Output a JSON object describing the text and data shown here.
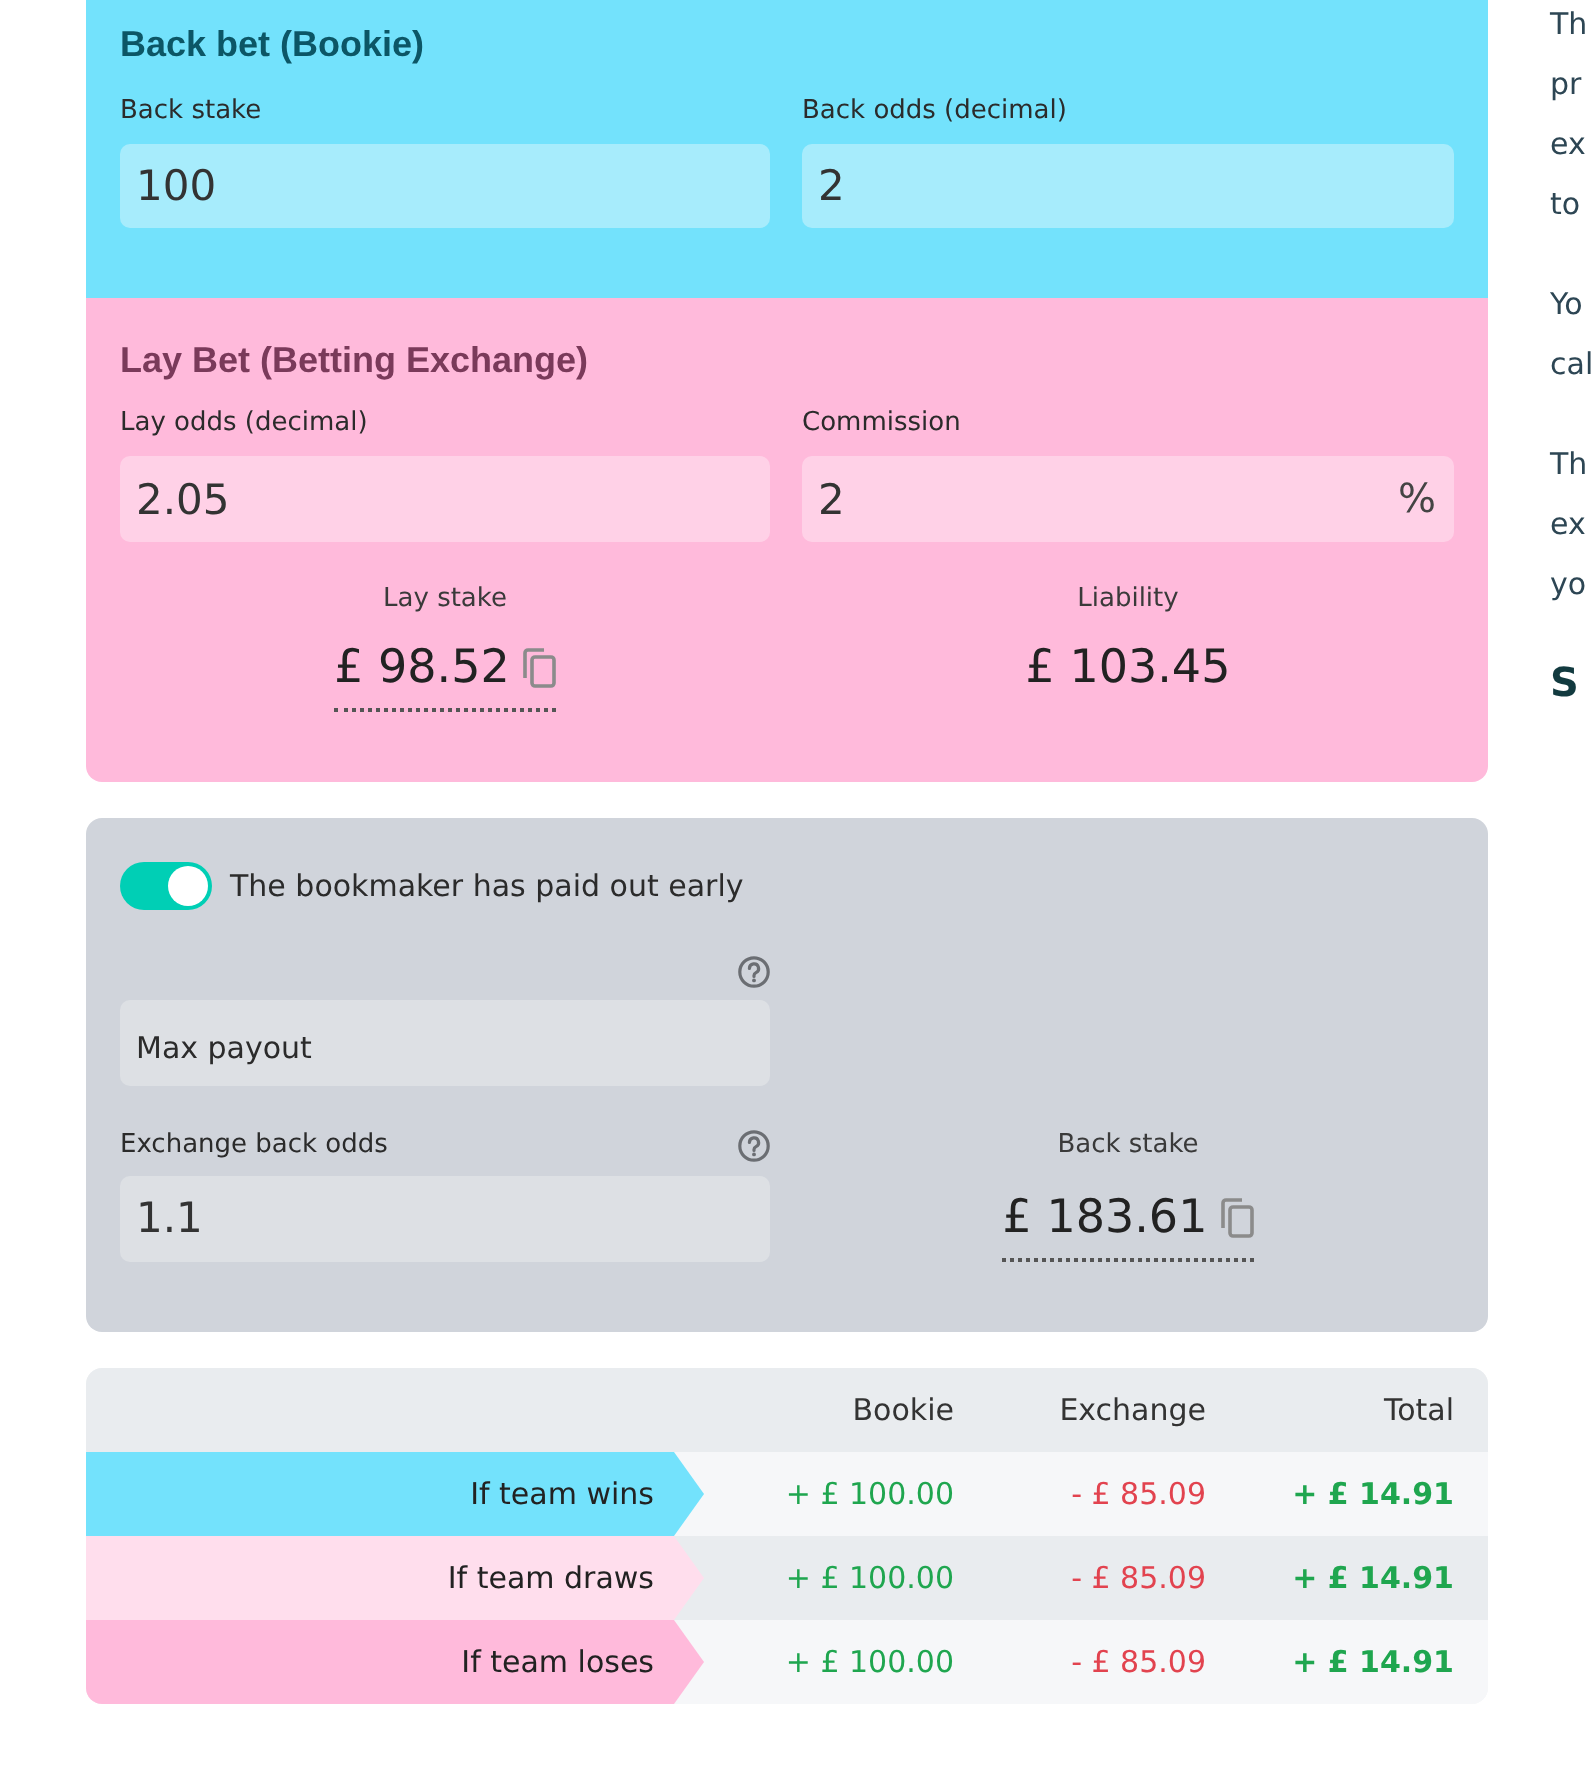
{
  "back_bet": {
    "title": "Back bet (Bookie)",
    "fields": [
      {
        "label": "Back stake",
        "value": "100"
      },
      {
        "label": "Back odds (decimal)",
        "value": "2"
      }
    ]
  },
  "lay_bet": {
    "title": "Lay Bet (Betting Exchange)",
    "fields": [
      {
        "label": "Lay odds (decimal)",
        "value": "2.05"
      },
      {
        "label": "Commission",
        "value": "2",
        "suffix": "%"
      }
    ],
    "results": [
      {
        "label": "Lay stake",
        "value": "£ 98.52",
        "copyable": true
      },
      {
        "label": "Liability",
        "value": "£ 103.45",
        "copyable": false
      }
    ]
  },
  "early_payout": {
    "toggle": {
      "label": "The bookmaker has paid out early",
      "on": true
    },
    "max_payout": {
      "placeholder": "Max payout",
      "help": true
    },
    "exchange_back_odds": {
      "label": "Exchange back odds",
      "value": "1.1",
      "help": true
    },
    "result": {
      "label": "Back stake",
      "value": "£ 183.61",
      "copyable": true
    }
  },
  "outcomes_table": {
    "columns": [
      "Bookie",
      "Exchange",
      "Total"
    ],
    "rows": [
      {
        "outcome": "If team wins",
        "color": "#73e2fc",
        "cells": [
          {
            "text": "+ £ 100.00",
            "kind": "gain"
          },
          {
            "text": "- £ 85.09",
            "kind": "loss"
          },
          {
            "text": "+ £ 14.91",
            "kind": "gain"
          }
        ]
      },
      {
        "outcome": "If team draws",
        "color": "#ffdeed",
        "cells": [
          {
            "text": "+ £ 100.00",
            "kind": "gain"
          },
          {
            "text": "- £ 85.09",
            "kind": "loss"
          },
          {
            "text": "+ £ 14.91",
            "kind": "gain"
          }
        ]
      },
      {
        "outcome": "If team loses",
        "color": "#ffbadb",
        "cells": [
          {
            "text": "+ £ 100.00",
            "kind": "gain"
          },
          {
            "text": "- £ 85.09",
            "kind": "loss"
          },
          {
            "text": "+ £ 14.91",
            "kind": "gain"
          }
        ]
      }
    ]
  },
  "side_text": {
    "paragraphs": [
      {
        "lines": [
          "Th",
          "pr",
          "ex",
          "to"
        ]
      },
      {
        "lines": [
          "Yo",
          "cal"
        ]
      },
      {
        "lines": [
          "Th",
          "ex",
          "yo"
        ]
      }
    ],
    "heading": "S"
  }
}
